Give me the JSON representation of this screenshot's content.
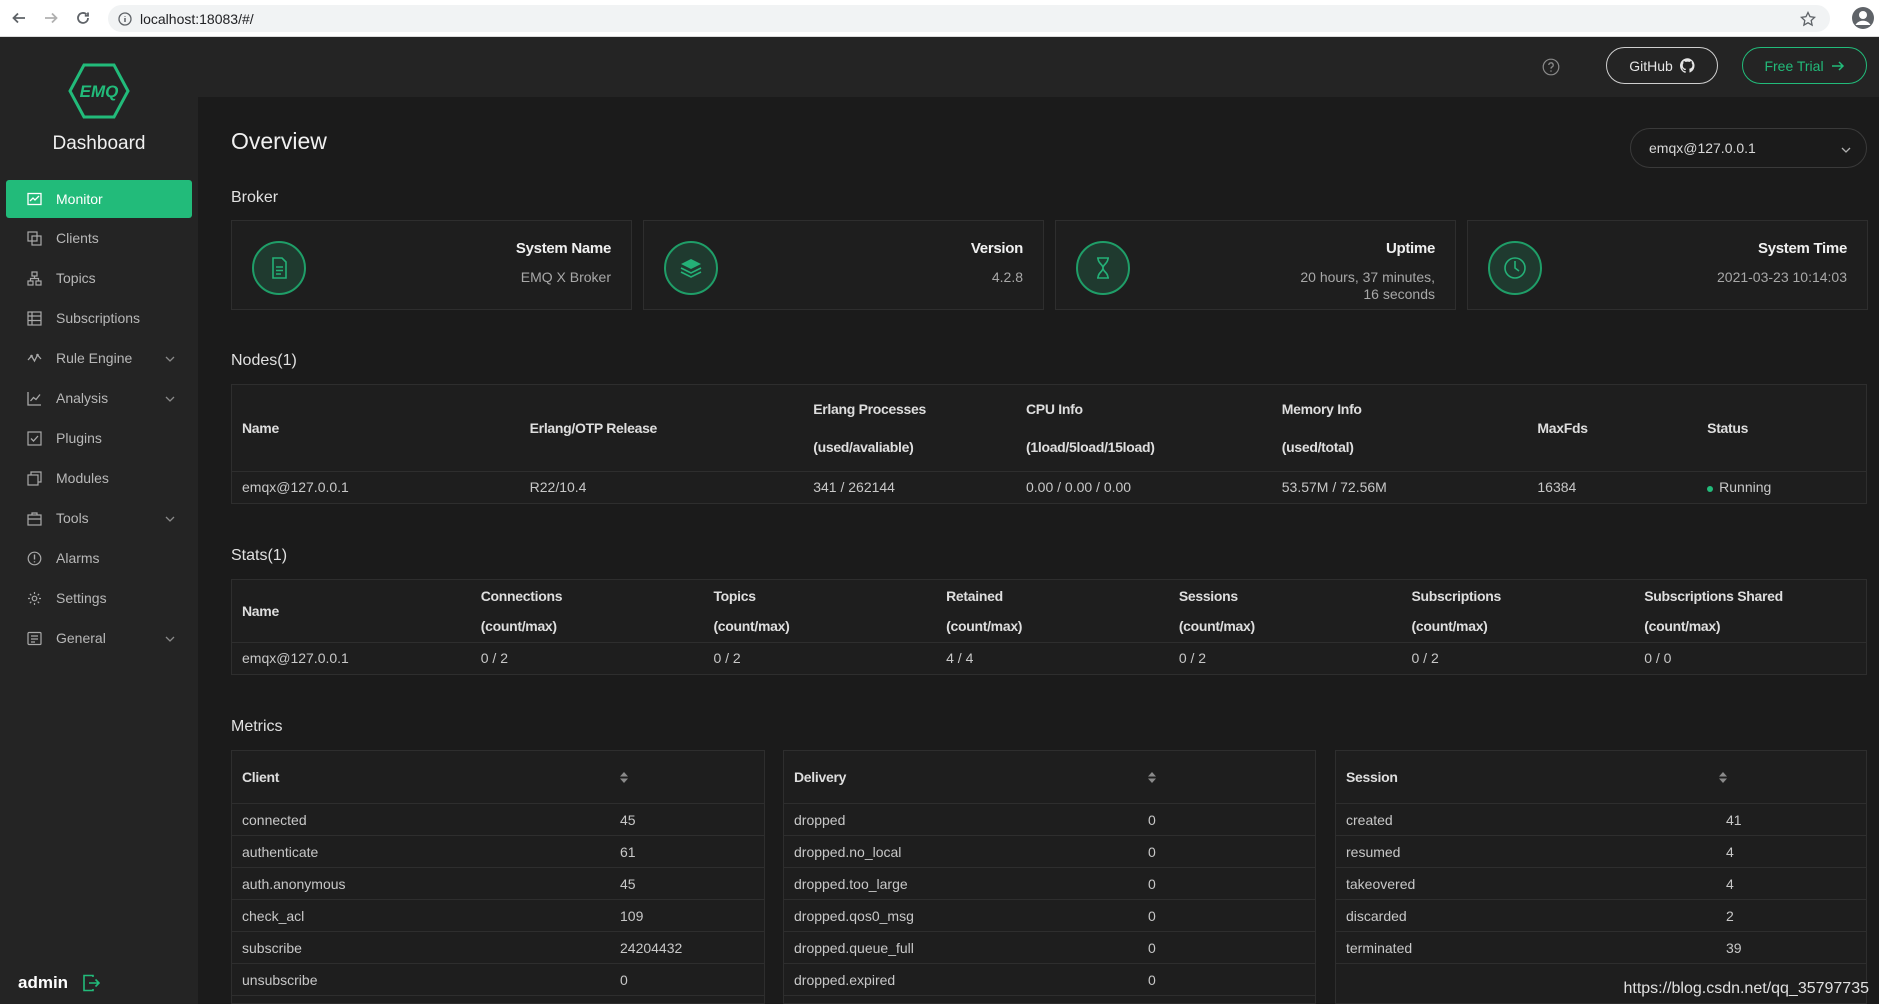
{
  "browser": {
    "url": "localhost:18083/#/"
  },
  "sidebar": {
    "brand": "Dashboard",
    "logo_text": "EMQ",
    "items": [
      {
        "label": "Monitor",
        "icon": "monitor-icon",
        "active": true,
        "expandable": false
      },
      {
        "label": "Clients",
        "icon": "clients-icon",
        "active": false,
        "expandable": false
      },
      {
        "label": "Topics",
        "icon": "topics-icon",
        "active": false,
        "expandable": false
      },
      {
        "label": "Subscriptions",
        "icon": "subscriptions-icon",
        "active": false,
        "expandable": false
      },
      {
        "label": "Rule Engine",
        "icon": "rule-engine-icon",
        "active": false,
        "expandable": true
      },
      {
        "label": "Analysis",
        "icon": "analysis-icon",
        "active": false,
        "expandable": true
      },
      {
        "label": "Plugins",
        "icon": "plugins-icon",
        "active": false,
        "expandable": false
      },
      {
        "label": "Modules",
        "icon": "modules-icon",
        "active": false,
        "expandable": false
      },
      {
        "label": "Tools",
        "icon": "tools-icon",
        "active": false,
        "expandable": true
      },
      {
        "label": "Alarms",
        "icon": "alarms-icon",
        "active": false,
        "expandable": false
      },
      {
        "label": "Settings",
        "icon": "settings-icon",
        "active": false,
        "expandable": false
      },
      {
        "label": "General",
        "icon": "general-icon",
        "active": false,
        "expandable": true
      }
    ],
    "user": "admin"
  },
  "header": {
    "github_label": "GitHub",
    "trial_label": "Free Trial"
  },
  "page": {
    "title": "Overview",
    "node_select": "emqx@127.0.0.1"
  },
  "broker": {
    "label": "Broker",
    "cards": [
      {
        "title": "System Name",
        "value": "EMQ X Broker",
        "icon": "document-icon"
      },
      {
        "title": "Version",
        "value": "4.2.8",
        "icon": "layers-icon"
      },
      {
        "title": "Uptime",
        "value": "20 hours, 37 minutes,",
        "value2": "16 seconds",
        "icon": "hourglass-icon"
      },
      {
        "title": "System Time",
        "value": "2021-03-23 10:14:03",
        "icon": "clock-icon"
      }
    ]
  },
  "nodes": {
    "label": "Nodes(1)",
    "headers": [
      {
        "l1": "Name",
        "l2": ""
      },
      {
        "l1": "Erlang/OTP Release",
        "l2": ""
      },
      {
        "l1": "Erlang Processes",
        "l2": "(used/avaliable)"
      },
      {
        "l1": "CPU Info",
        "l2": "(1load/5load/15load)"
      },
      {
        "l1": "Memory Info",
        "l2": "(used/total)"
      },
      {
        "l1": "MaxFds",
        "l2": ""
      },
      {
        "l1": "Status",
        "l2": ""
      }
    ],
    "rows": [
      [
        "emqx@127.0.0.1",
        "R22/10.4",
        "341 / 262144",
        "0.00 / 0.00 / 0.00",
        "53.57M / 72.56M",
        "16384",
        "Running"
      ]
    ]
  },
  "stats": {
    "label": "Stats(1)",
    "headers": [
      {
        "l1": "Name",
        "l2": ""
      },
      {
        "l1": "Connections",
        "l2": "(count/max)"
      },
      {
        "l1": "Topics",
        "l2": "(count/max)"
      },
      {
        "l1": "Retained",
        "l2": "(count/max)"
      },
      {
        "l1": "Sessions",
        "l2": "(count/max)"
      },
      {
        "l1": "Subscriptions",
        "l2": "(count/max)"
      },
      {
        "l1": "Subscriptions Shared",
        "l2": "(count/max)"
      }
    ],
    "rows": [
      [
        "emqx@127.0.0.1",
        "0 / 2",
        "0 / 2",
        "4 / 4",
        "0 / 2",
        "0 / 2",
        "0 / 0"
      ]
    ]
  },
  "metrics": {
    "label": "Metrics",
    "panels": [
      {
        "title": "Client",
        "rows": [
          [
            "connected",
            "45"
          ],
          [
            "authenticate",
            "61"
          ],
          [
            "auth.anonymous",
            "45"
          ],
          [
            "check_acl",
            "109"
          ],
          [
            "subscribe",
            "24204432"
          ],
          [
            "unsubscribe",
            "0"
          ]
        ]
      },
      {
        "title": "Delivery",
        "rows": [
          [
            "dropped",
            "0"
          ],
          [
            "dropped.no_local",
            "0"
          ],
          [
            "dropped.too_large",
            "0"
          ],
          [
            "dropped.qos0_msg",
            "0"
          ],
          [
            "dropped.queue_full",
            "0"
          ],
          [
            "dropped.expired",
            "0"
          ]
        ]
      },
      {
        "title": "Session",
        "rows": [
          [
            "created",
            "41"
          ],
          [
            "resumed",
            "4"
          ],
          [
            "takeovered",
            "4"
          ],
          [
            "discarded",
            "2"
          ],
          [
            "terminated",
            "39"
          ]
        ]
      }
    ]
  },
  "watermark": "https://blog.csdn.net/qq_35797735",
  "colors": {
    "accent": "#22bb7a",
    "sidebar_bg": "#242424",
    "page_bg": "#1b1b1b"
  }
}
